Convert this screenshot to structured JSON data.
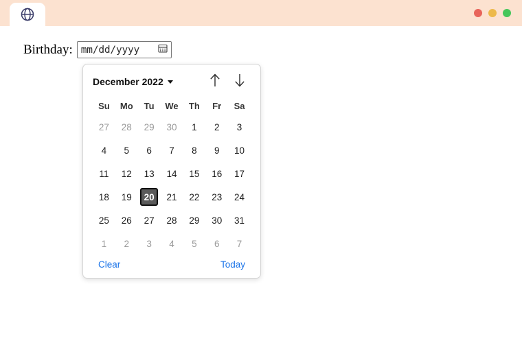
{
  "browser": {
    "tab": {
      "icon": "globe-icon",
      "label": ""
    },
    "window_controls": {
      "close": "close-dot",
      "minimize": "minimize-dot",
      "maximize": "maximize-dot"
    },
    "colors": {
      "header_bg": "#fce2d0",
      "close": "#e8645a",
      "minimize": "#edb94a",
      "maximize": "#46c65a",
      "globe": "#3d3f6b"
    }
  },
  "form": {
    "label": "Birthday:",
    "date_input": {
      "value": "",
      "placeholder": "mm/dd/yyyy",
      "picker_icon": "calendar-icon"
    }
  },
  "calendar": {
    "month_label": "December 2022",
    "month_caret": "chevron-down-icon",
    "prev_icon": "arrow-up-icon",
    "next_icon": "arrow-down-icon",
    "weekdays": [
      "Su",
      "Mo",
      "Tu",
      "We",
      "Th",
      "Fr",
      "Sa"
    ],
    "weeks": [
      [
        {
          "d": "27",
          "muted": true,
          "selected": false
        },
        {
          "d": "28",
          "muted": true,
          "selected": false
        },
        {
          "d": "29",
          "muted": true,
          "selected": false
        },
        {
          "d": "30",
          "muted": true,
          "selected": false
        },
        {
          "d": "1",
          "muted": false,
          "selected": false
        },
        {
          "d": "2",
          "muted": false,
          "selected": false
        },
        {
          "d": "3",
          "muted": false,
          "selected": false
        }
      ],
      [
        {
          "d": "4",
          "muted": false,
          "selected": false
        },
        {
          "d": "5",
          "muted": false,
          "selected": false
        },
        {
          "d": "6",
          "muted": false,
          "selected": false
        },
        {
          "d": "7",
          "muted": false,
          "selected": false
        },
        {
          "d": "8",
          "muted": false,
          "selected": false
        },
        {
          "d": "9",
          "muted": false,
          "selected": false
        },
        {
          "d": "10",
          "muted": false,
          "selected": false
        }
      ],
      [
        {
          "d": "11",
          "muted": false,
          "selected": false
        },
        {
          "d": "12",
          "muted": false,
          "selected": false
        },
        {
          "d": "13",
          "muted": false,
          "selected": false
        },
        {
          "d": "14",
          "muted": false,
          "selected": false
        },
        {
          "d": "15",
          "muted": false,
          "selected": false
        },
        {
          "d": "16",
          "muted": false,
          "selected": false
        },
        {
          "d": "17",
          "muted": false,
          "selected": false
        }
      ],
      [
        {
          "d": "18",
          "muted": false,
          "selected": false
        },
        {
          "d": "19",
          "muted": false,
          "selected": false
        },
        {
          "d": "20",
          "muted": false,
          "selected": true
        },
        {
          "d": "21",
          "muted": false,
          "selected": false
        },
        {
          "d": "22",
          "muted": false,
          "selected": false
        },
        {
          "d": "23",
          "muted": false,
          "selected": false
        },
        {
          "d": "24",
          "muted": false,
          "selected": false
        }
      ],
      [
        {
          "d": "25",
          "muted": false,
          "selected": false
        },
        {
          "d": "26",
          "muted": false,
          "selected": false
        },
        {
          "d": "27",
          "muted": false,
          "selected": false
        },
        {
          "d": "28",
          "muted": false,
          "selected": false
        },
        {
          "d": "29",
          "muted": false,
          "selected": false
        },
        {
          "d": "30",
          "muted": false,
          "selected": false
        },
        {
          "d": "31",
          "muted": false,
          "selected": false
        }
      ],
      [
        {
          "d": "1",
          "muted": true,
          "selected": false
        },
        {
          "d": "2",
          "muted": true,
          "selected": false
        },
        {
          "d": "3",
          "muted": true,
          "selected": false
        },
        {
          "d": "4",
          "muted": true,
          "selected": false
        },
        {
          "d": "5",
          "muted": true,
          "selected": false
        },
        {
          "d": "6",
          "muted": true,
          "selected": false
        },
        {
          "d": "7",
          "muted": true,
          "selected": false
        }
      ]
    ],
    "clear_label": "Clear",
    "today_label": "Today",
    "link_color": "#1a73e8",
    "selected_bg": "#5b5b5b"
  }
}
